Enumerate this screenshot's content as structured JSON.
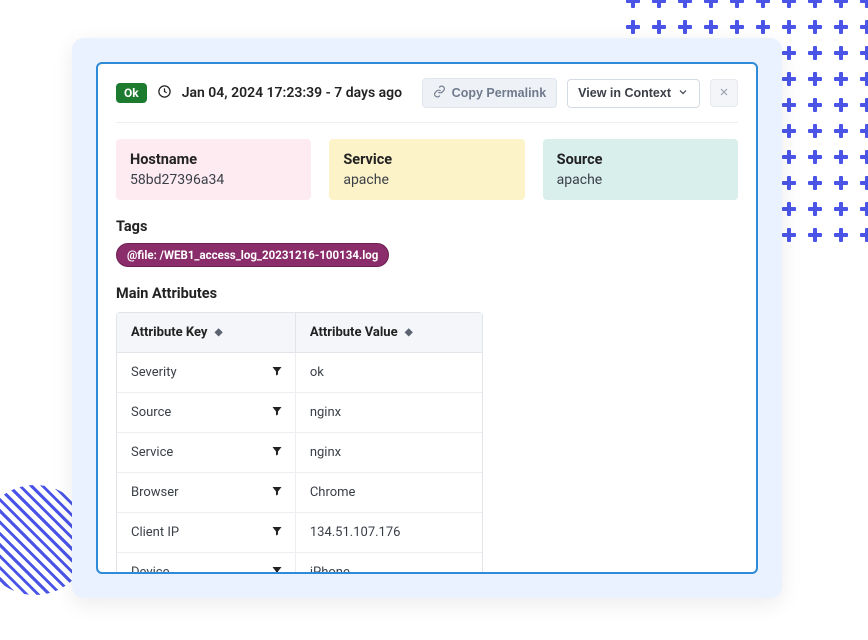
{
  "header": {
    "status": "Ok",
    "timestamp": "Jan 04, 2024 17:23:39 - 7 days ago",
    "copy_label": "Copy Permalink",
    "view_label": "View in Context"
  },
  "info": {
    "hostname": {
      "label": "Hostname",
      "value": "58bd27396a34"
    },
    "service": {
      "label": "Service",
      "value": "apache"
    },
    "source": {
      "label": "Source",
      "value": "apache"
    }
  },
  "tags": {
    "title": "Tags",
    "items": [
      "@file: /WEB1_access_log_20231216-100134.log"
    ]
  },
  "attributes": {
    "title": "Main Attributes",
    "col_key": "Attribute Key",
    "col_val": "Attribute Value",
    "rows": [
      {
        "key": "Severity",
        "value": "ok"
      },
      {
        "key": "Source",
        "value": "nginx"
      },
      {
        "key": "Service",
        "value": "nginx"
      },
      {
        "key": "Browser",
        "value": "Chrome"
      },
      {
        "key": "Client IP",
        "value": "134.51.107.176"
      },
      {
        "key": "Device",
        "value": "iPhone"
      }
    ]
  }
}
